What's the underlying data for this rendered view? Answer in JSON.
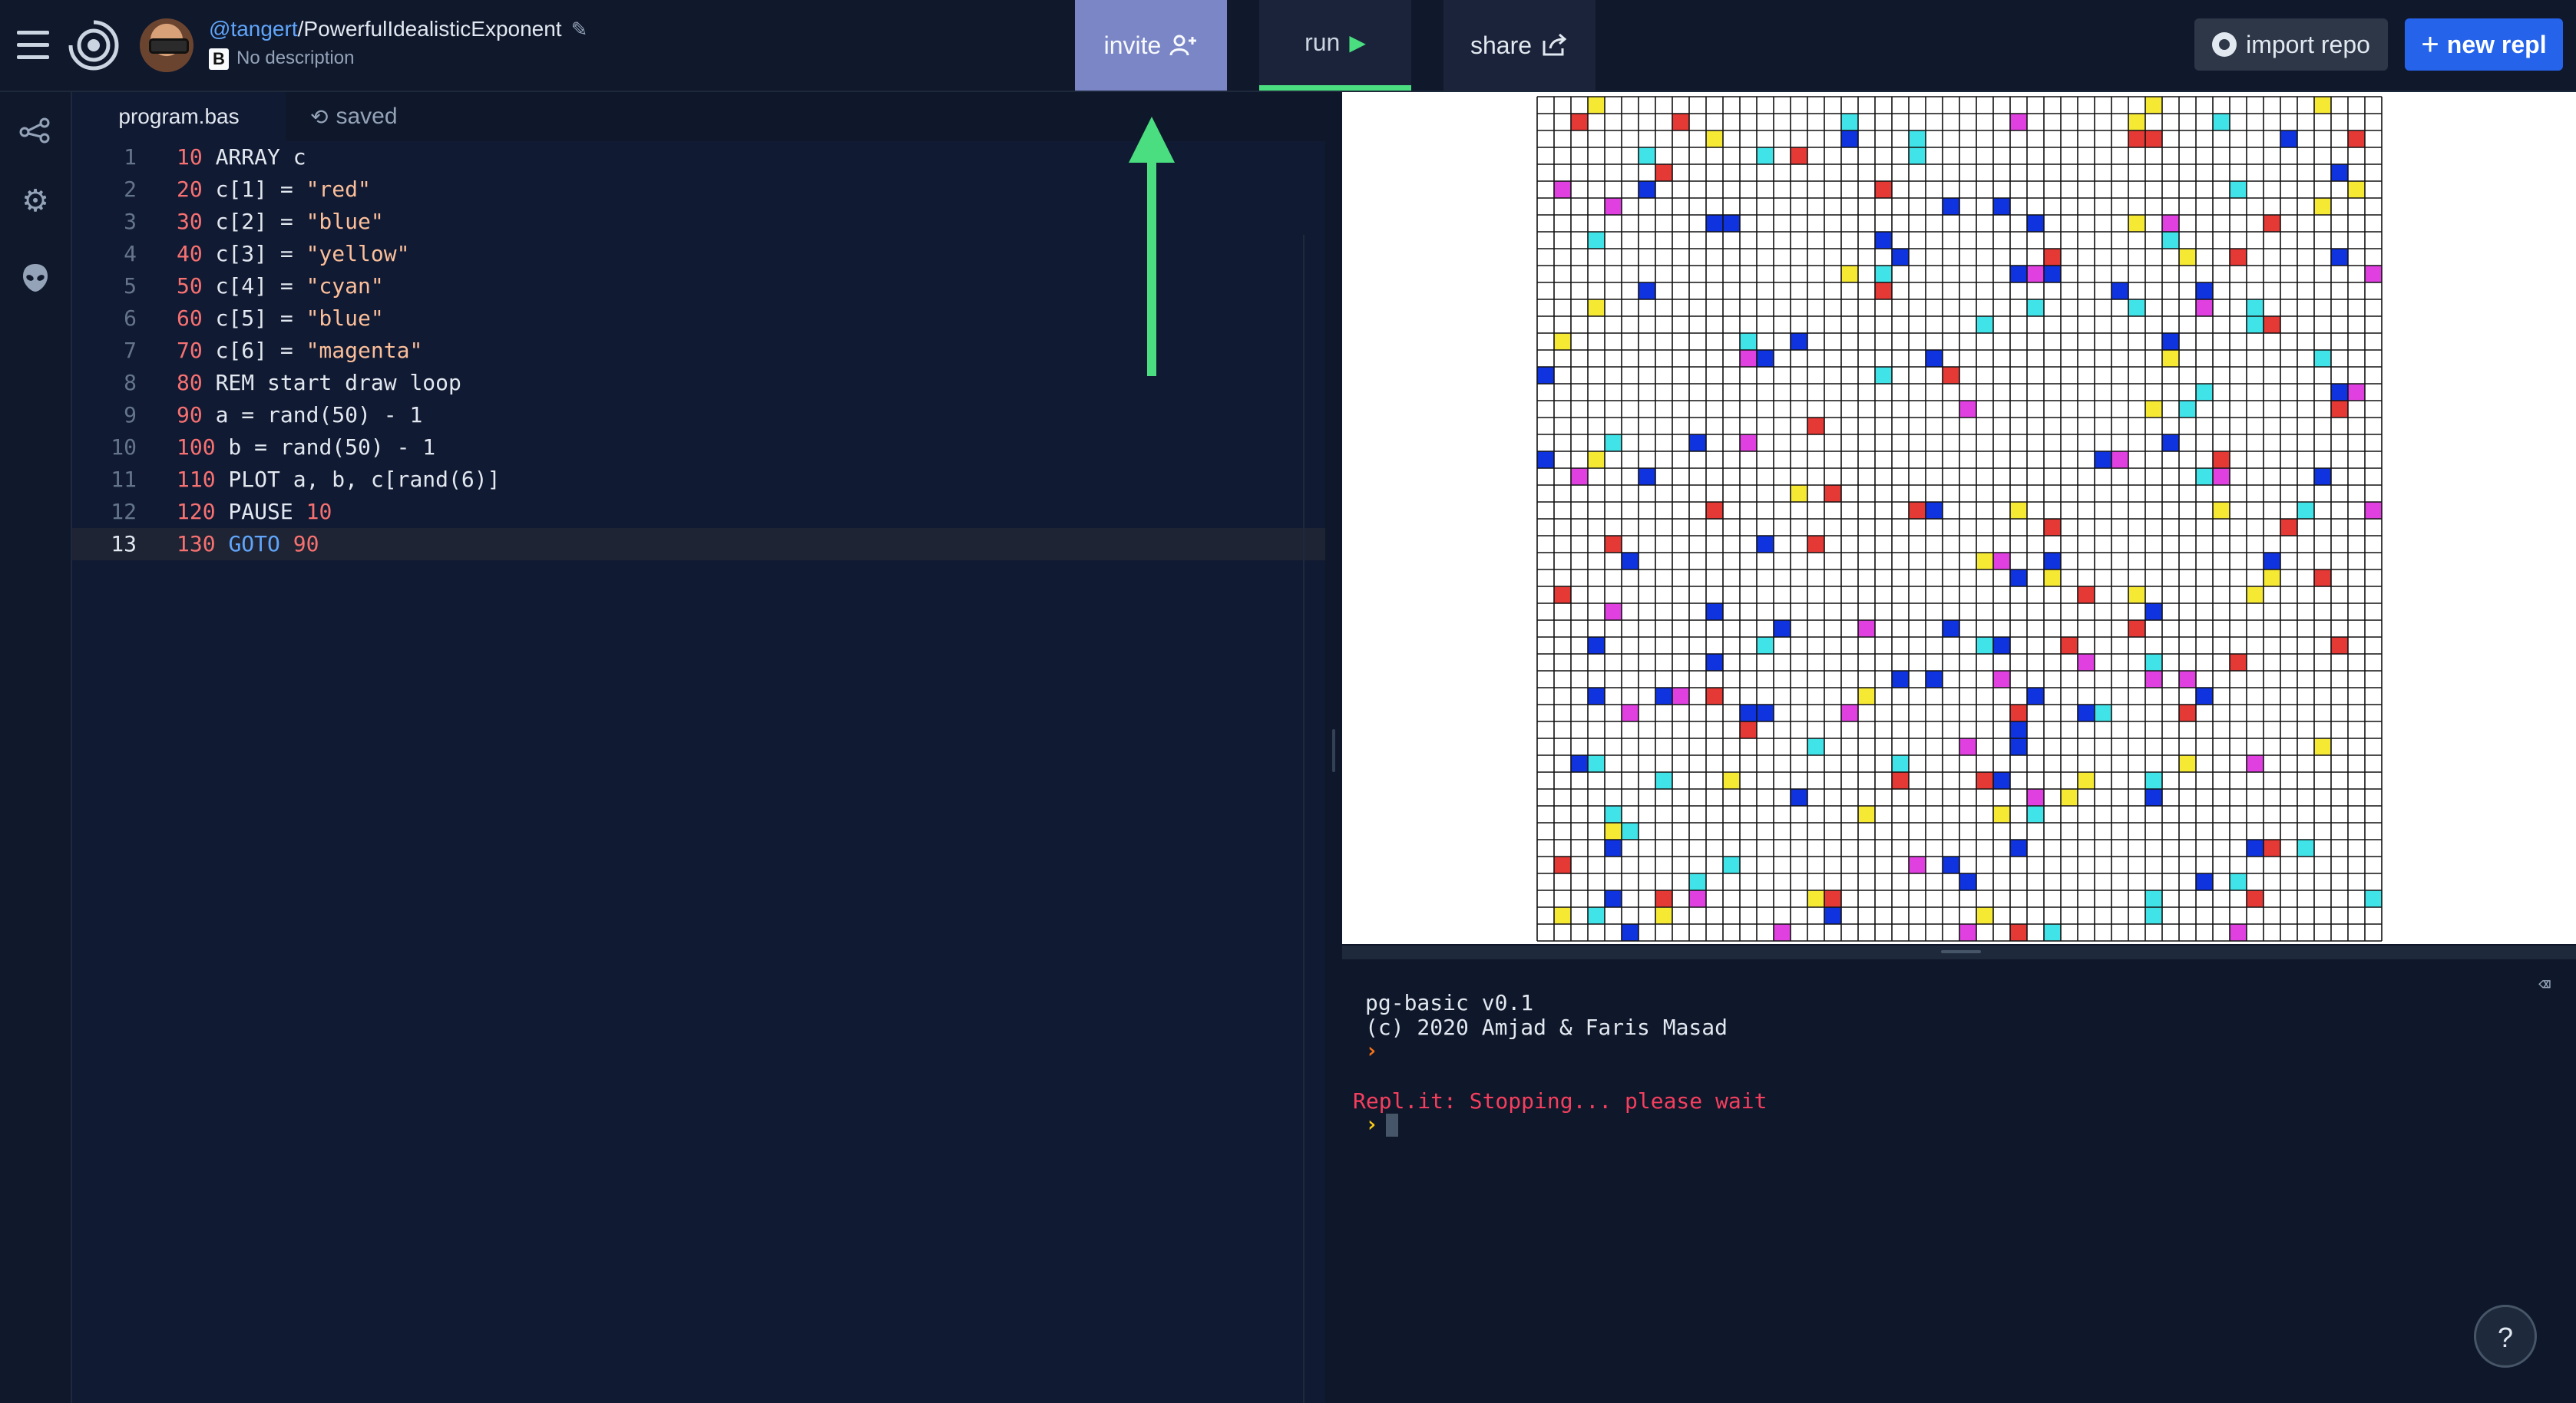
{
  "header": {
    "repl_owner": "@tangert",
    "repl_separator": "/",
    "repl_name": "PowerfulIdealisticExponent",
    "lang_badge": "B",
    "description": "No description",
    "invite_label": "invite",
    "run_label": "run",
    "share_label": "share",
    "import_label": "import repo",
    "new_repl_label": "new repl"
  },
  "editor": {
    "tab_name": "program.bas",
    "save_status": "saved",
    "lines": [
      {
        "n": "1",
        "tokens": [
          [
            "num",
            "10"
          ],
          [
            "txt",
            " ARRAY c"
          ]
        ]
      },
      {
        "n": "2",
        "tokens": [
          [
            "num",
            "20"
          ],
          [
            "txt",
            " c[1] = "
          ],
          [
            "str",
            "\"red\""
          ]
        ]
      },
      {
        "n": "3",
        "tokens": [
          [
            "num",
            "30"
          ],
          [
            "txt",
            " c[2] = "
          ],
          [
            "str",
            "\"blue\""
          ]
        ]
      },
      {
        "n": "4",
        "tokens": [
          [
            "num",
            "40"
          ],
          [
            "txt",
            " c[3] = "
          ],
          [
            "str",
            "\"yellow\""
          ]
        ]
      },
      {
        "n": "5",
        "tokens": [
          [
            "num",
            "50"
          ],
          [
            "txt",
            " c[4] = "
          ],
          [
            "str",
            "\"cyan\""
          ]
        ]
      },
      {
        "n": "6",
        "tokens": [
          [
            "num",
            "60"
          ],
          [
            "txt",
            " c[5] = "
          ],
          [
            "str",
            "\"blue\""
          ]
        ]
      },
      {
        "n": "7",
        "tokens": [
          [
            "num",
            "70"
          ],
          [
            "txt",
            " c[6] = "
          ],
          [
            "str",
            "\"magenta\""
          ]
        ]
      },
      {
        "n": "8",
        "tokens": [
          [
            "num",
            "80"
          ],
          [
            "txt",
            " REM start draw loop"
          ]
        ]
      },
      {
        "n": "9",
        "tokens": [
          [
            "num",
            "90"
          ],
          [
            "txt",
            " a = rand(50) - 1"
          ]
        ]
      },
      {
        "n": "10",
        "tokens": [
          [
            "num",
            "100"
          ],
          [
            "txt",
            " b = rand(50) - 1"
          ]
        ]
      },
      {
        "n": "11",
        "tokens": [
          [
            "num",
            "110"
          ],
          [
            "txt",
            " PLOT a, b, c[rand(6)]"
          ]
        ]
      },
      {
        "n": "12",
        "tokens": [
          [
            "num",
            "120"
          ],
          [
            "txt",
            " PAUSE "
          ],
          [
            "num",
            "10"
          ]
        ]
      },
      {
        "n": "13",
        "tokens": [
          [
            "num",
            "130"
          ],
          [
            "txt",
            " "
          ],
          [
            "kw",
            "GOTO"
          ],
          [
            "txt",
            " "
          ],
          [
            "num",
            "90"
          ]
        ],
        "active": true
      }
    ]
  },
  "canvas": {
    "cells_per_side": 50,
    "palette": {
      "R": "#e53935",
      "B": "#1033e0",
      "Y": "#f5e934",
      "C": "#3fe3e8",
      "M": "#e040e0"
    },
    "cells": [
      [
        3,
        0,
        "Y"
      ],
      [
        36,
        0,
        "Y"
      ],
      [
        46,
        0,
        "Y"
      ],
      [
        2,
        1,
        "R"
      ],
      [
        8,
        1,
        "R"
      ],
      [
        18,
        1,
        "C"
      ],
      [
        28,
        1,
        "M"
      ],
      [
        35,
        1,
        "Y"
      ],
      [
        40,
        1,
        "C"
      ],
      [
        10,
        2,
        "Y"
      ],
      [
        18,
        2,
        "B"
      ],
      [
        22,
        2,
        "C"
      ],
      [
        35,
        2,
        "R"
      ],
      [
        36,
        2,
        "R"
      ],
      [
        44,
        2,
        "B"
      ],
      [
        48,
        2,
        "R"
      ],
      [
        6,
        3,
        "C"
      ],
      [
        13,
        3,
        "C"
      ],
      [
        15,
        3,
        "R"
      ],
      [
        22,
        3,
        "C"
      ],
      [
        7,
        4,
        "R"
      ],
      [
        47,
        4,
        "B"
      ],
      [
        1,
        5,
        "M"
      ],
      [
        6,
        5,
        "B"
      ],
      [
        20,
        5,
        "R"
      ],
      [
        41,
        5,
        "C"
      ],
      [
        48,
        5,
        "Y"
      ],
      [
        4,
        6,
        "M"
      ],
      [
        24,
        6,
        "B"
      ],
      [
        27,
        6,
        "B"
      ],
      [
        46,
        6,
        "Y"
      ],
      [
        10,
        7,
        "B"
      ],
      [
        11,
        7,
        "B"
      ],
      [
        29,
        7,
        "B"
      ],
      [
        35,
        7,
        "Y"
      ],
      [
        37,
        7,
        "M"
      ],
      [
        43,
        7,
        "R"
      ],
      [
        3,
        8,
        "C"
      ],
      [
        20,
        8,
        "B"
      ],
      [
        37,
        8,
        "C"
      ],
      [
        21,
        9,
        "B"
      ],
      [
        30,
        9,
        "R"
      ],
      [
        38,
        9,
        "Y"
      ],
      [
        41,
        9,
        "R"
      ],
      [
        47,
        9,
        "B"
      ],
      [
        18,
        10,
        "Y"
      ],
      [
        20,
        10,
        "C"
      ],
      [
        28,
        10,
        "B"
      ],
      [
        29,
        10,
        "M"
      ],
      [
        30,
        10,
        "B"
      ],
      [
        49,
        10,
        "M"
      ],
      [
        6,
        11,
        "B"
      ],
      [
        20,
        11,
        "R"
      ],
      [
        34,
        11,
        "B"
      ],
      [
        39,
        11,
        "B"
      ],
      [
        3,
        12,
        "Y"
      ],
      [
        29,
        12,
        "C"
      ],
      [
        35,
        12,
        "C"
      ],
      [
        39,
        12,
        "M"
      ],
      [
        42,
        12,
        "C"
      ],
      [
        26,
        13,
        "C"
      ],
      [
        42,
        13,
        "C"
      ],
      [
        43,
        13,
        "R"
      ],
      [
        1,
        14,
        "Y"
      ],
      [
        12,
        14,
        "C"
      ],
      [
        15,
        14,
        "B"
      ],
      [
        37,
        14,
        "B"
      ],
      [
        12,
        15,
        "M"
      ],
      [
        13,
        15,
        "B"
      ],
      [
        23,
        15,
        "B"
      ],
      [
        37,
        15,
        "Y"
      ],
      [
        46,
        15,
        "C"
      ],
      [
        0,
        16,
        "B"
      ],
      [
        20,
        16,
        "C"
      ],
      [
        24,
        16,
        "R"
      ],
      [
        39,
        17,
        "C"
      ],
      [
        47,
        17,
        "B"
      ],
      [
        48,
        17,
        "M"
      ],
      [
        25,
        18,
        "M"
      ],
      [
        36,
        18,
        "Y"
      ],
      [
        38,
        18,
        "C"
      ],
      [
        47,
        18,
        "R"
      ],
      [
        16,
        19,
        "R"
      ],
      [
        4,
        20,
        "C"
      ],
      [
        9,
        20,
        "B"
      ],
      [
        12,
        20,
        "M"
      ],
      [
        37,
        20,
        "B"
      ],
      [
        0,
        21,
        "B"
      ],
      [
        3,
        21,
        "Y"
      ],
      [
        33,
        21,
        "B"
      ],
      [
        34,
        21,
        "M"
      ],
      [
        40,
        21,
        "R"
      ],
      [
        2,
        22,
        "M"
      ],
      [
        6,
        22,
        "B"
      ],
      [
        39,
        22,
        "C"
      ],
      [
        40,
        22,
        "M"
      ],
      [
        46,
        22,
        "B"
      ],
      [
        15,
        23,
        "Y"
      ],
      [
        17,
        23,
        "R"
      ],
      [
        10,
        24,
        "R"
      ],
      [
        22,
        24,
        "R"
      ],
      [
        23,
        24,
        "B"
      ],
      [
        28,
        24,
        "Y"
      ],
      [
        40,
        24,
        "Y"
      ],
      [
        45,
        24,
        "C"
      ],
      [
        49,
        24,
        "M"
      ],
      [
        30,
        25,
        "R"
      ],
      [
        44,
        25,
        "R"
      ],
      [
        4,
        26,
        "R"
      ],
      [
        13,
        26,
        "B"
      ],
      [
        16,
        26,
        "R"
      ],
      [
        5,
        27,
        "B"
      ],
      [
        26,
        27,
        "Y"
      ],
      [
        27,
        27,
        "M"
      ],
      [
        30,
        27,
        "B"
      ],
      [
        43,
        27,
        "B"
      ],
      [
        28,
        28,
        "B"
      ],
      [
        30,
        28,
        "Y"
      ],
      [
        43,
        28,
        "Y"
      ],
      [
        46,
        28,
        "R"
      ],
      [
        1,
        29,
        "R"
      ],
      [
        32,
        29,
        "R"
      ],
      [
        35,
        29,
        "Y"
      ],
      [
        42,
        29,
        "Y"
      ],
      [
        4,
        30,
        "M"
      ],
      [
        10,
        30,
        "B"
      ],
      [
        36,
        30,
        "B"
      ],
      [
        14,
        31,
        "B"
      ],
      [
        19,
        31,
        "M"
      ],
      [
        24,
        31,
        "B"
      ],
      [
        35,
        31,
        "R"
      ],
      [
        3,
        32,
        "B"
      ],
      [
        13,
        32,
        "C"
      ],
      [
        26,
        32,
        "C"
      ],
      [
        27,
        32,
        "B"
      ],
      [
        31,
        32,
        "R"
      ],
      [
        47,
        32,
        "R"
      ],
      [
        10,
        33,
        "B"
      ],
      [
        32,
        33,
        "M"
      ],
      [
        36,
        33,
        "C"
      ],
      [
        41,
        33,
        "R"
      ],
      [
        21,
        34,
        "B"
      ],
      [
        23,
        34,
        "B"
      ],
      [
        27,
        34,
        "M"
      ],
      [
        36,
        34,
        "M"
      ],
      [
        38,
        34,
        "M"
      ],
      [
        3,
        35,
        "B"
      ],
      [
        7,
        35,
        "B"
      ],
      [
        8,
        35,
        "M"
      ],
      [
        10,
        35,
        "R"
      ],
      [
        19,
        35,
        "Y"
      ],
      [
        29,
        35,
        "B"
      ],
      [
        39,
        35,
        "B"
      ],
      [
        5,
        36,
        "M"
      ],
      [
        12,
        36,
        "B"
      ],
      [
        13,
        36,
        "B"
      ],
      [
        18,
        36,
        "M"
      ],
      [
        28,
        36,
        "R"
      ],
      [
        32,
        36,
        "B"
      ],
      [
        33,
        36,
        "C"
      ],
      [
        38,
        36,
        "R"
      ],
      [
        12,
        37,
        "R"
      ],
      [
        28,
        37,
        "B"
      ],
      [
        16,
        38,
        "C"
      ],
      [
        25,
        38,
        "M"
      ],
      [
        28,
        38,
        "B"
      ],
      [
        46,
        38,
        "Y"
      ],
      [
        2,
        39,
        "B"
      ],
      [
        3,
        39,
        "C"
      ],
      [
        21,
        39,
        "C"
      ],
      [
        38,
        39,
        "Y"
      ],
      [
        42,
        39,
        "M"
      ],
      [
        7,
        40,
        "C"
      ],
      [
        11,
        40,
        "Y"
      ],
      [
        21,
        40,
        "R"
      ],
      [
        26,
        40,
        "R"
      ],
      [
        27,
        40,
        "B"
      ],
      [
        32,
        40,
        "Y"
      ],
      [
        36,
        40,
        "C"
      ],
      [
        15,
        41,
        "B"
      ],
      [
        29,
        41,
        "M"
      ],
      [
        31,
        41,
        "Y"
      ],
      [
        36,
        41,
        "B"
      ],
      [
        4,
        42,
        "C"
      ],
      [
        19,
        42,
        "Y"
      ],
      [
        27,
        42,
        "Y"
      ],
      [
        29,
        42,
        "C"
      ],
      [
        4,
        43,
        "Y"
      ],
      [
        5,
        43,
        "C"
      ],
      [
        4,
        44,
        "B"
      ],
      [
        28,
        44,
        "B"
      ],
      [
        42,
        44,
        "B"
      ],
      [
        43,
        44,
        "R"
      ],
      [
        45,
        44,
        "C"
      ],
      [
        1,
        45,
        "R"
      ],
      [
        11,
        45,
        "C"
      ],
      [
        22,
        45,
        "M"
      ],
      [
        24,
        45,
        "B"
      ],
      [
        9,
        46,
        "C"
      ],
      [
        25,
        46,
        "B"
      ],
      [
        39,
        46,
        "B"
      ],
      [
        41,
        46,
        "C"
      ],
      [
        4,
        47,
        "B"
      ],
      [
        7,
        47,
        "R"
      ],
      [
        9,
        47,
        "M"
      ],
      [
        16,
        47,
        "Y"
      ],
      [
        17,
        47,
        "R"
      ],
      [
        36,
        47,
        "C"
      ],
      [
        42,
        47,
        "R"
      ],
      [
        49,
        47,
        "C"
      ],
      [
        1,
        48,
        "Y"
      ],
      [
        3,
        48,
        "C"
      ],
      [
        7,
        48,
        "Y"
      ],
      [
        17,
        48,
        "B"
      ],
      [
        26,
        48,
        "Y"
      ],
      [
        36,
        48,
        "C"
      ],
      [
        5,
        49,
        "B"
      ],
      [
        14,
        49,
        "M"
      ],
      [
        25,
        49,
        "M"
      ],
      [
        28,
        49,
        "R"
      ],
      [
        30,
        49,
        "C"
      ],
      [
        41,
        49,
        "M"
      ]
    ]
  },
  "console": {
    "line1": "pg-basic v0.1",
    "line2": "(c) 2020 Amjad & Faris Masad",
    "prompt": "›",
    "error": "Repl.it: Stopping... please wait"
  },
  "help_label": "?"
}
